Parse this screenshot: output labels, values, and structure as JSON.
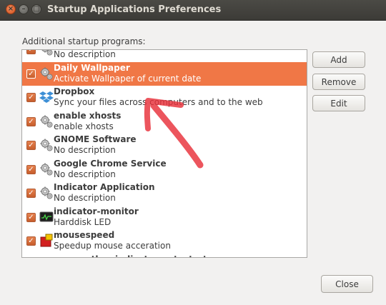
{
  "window": {
    "title": "Startup Applications Preferences",
    "controls": {
      "close_glyph": "×",
      "minimize_glyph": "–",
      "maximize_glyph": "□"
    }
  },
  "section_label": "Additional startup programs:",
  "programs": [
    {
      "name": "",
      "description": "No description",
      "checked": true,
      "icon": "gears-icon",
      "partial": "top"
    },
    {
      "name": "Daily Wallpaper",
      "description": "Activate Wallpaper of current date",
      "checked": true,
      "icon": "gears-icon",
      "selected": true
    },
    {
      "name": "Dropbox",
      "description": "Sync your files across computers and to the web",
      "checked": true,
      "icon": "dropbox-icon"
    },
    {
      "name": "enable xhosts",
      "description": "enable xhosts",
      "checked": true,
      "icon": "gears-icon"
    },
    {
      "name": "GNOME Software",
      "description": "No description",
      "checked": true,
      "icon": "gears-icon"
    },
    {
      "name": "Google Chrome Service",
      "description": "No description",
      "checked": true,
      "icon": "gears-icon"
    },
    {
      "name": "Indicator Application",
      "description": "No description",
      "checked": true,
      "icon": "gears-icon"
    },
    {
      "name": "indicator-monitor",
      "description": "Harddisk LED",
      "checked": true,
      "icon": "monitor-icon"
    },
    {
      "name": "mousespeed",
      "description": "Speedup mouse acceration",
      "checked": true,
      "icon": "mousespeed-icon"
    },
    {
      "name": "my-weather-indicator-autostart",
      "description": "",
      "checked": true,
      "icon": "gears-icon",
      "partial": "bottom"
    }
  ],
  "buttons": {
    "add": "Add",
    "remove": "Remove",
    "edit": "Edit",
    "close": "Close"
  },
  "colors": {
    "selection": "#f07746",
    "titlebar": "#3c3b37",
    "annotation_arrow": "#e8303a"
  },
  "check_glyph": "✓"
}
